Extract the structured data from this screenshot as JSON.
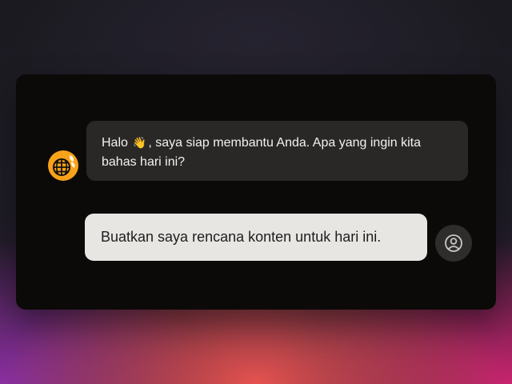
{
  "chat": {
    "bot": {
      "avatar_icon": "globe-leaf-icon",
      "message_before_emoji": "Halo",
      "emoji": "👋",
      "message_after_emoji": ", saya siap membantu Anda. Apa yang ingin kita bahas hari ini?"
    },
    "user": {
      "avatar_icon": "user-circle-icon",
      "message": "Buatkan saya rencana konten untuk hari ini."
    }
  },
  "colors": {
    "panel": "#0c0a08",
    "bot_bubble": "#2a2827",
    "user_bubble": "#e8e6e3",
    "bot_avatar": "#f7a21b",
    "user_avatar": "#2f2d2c"
  }
}
